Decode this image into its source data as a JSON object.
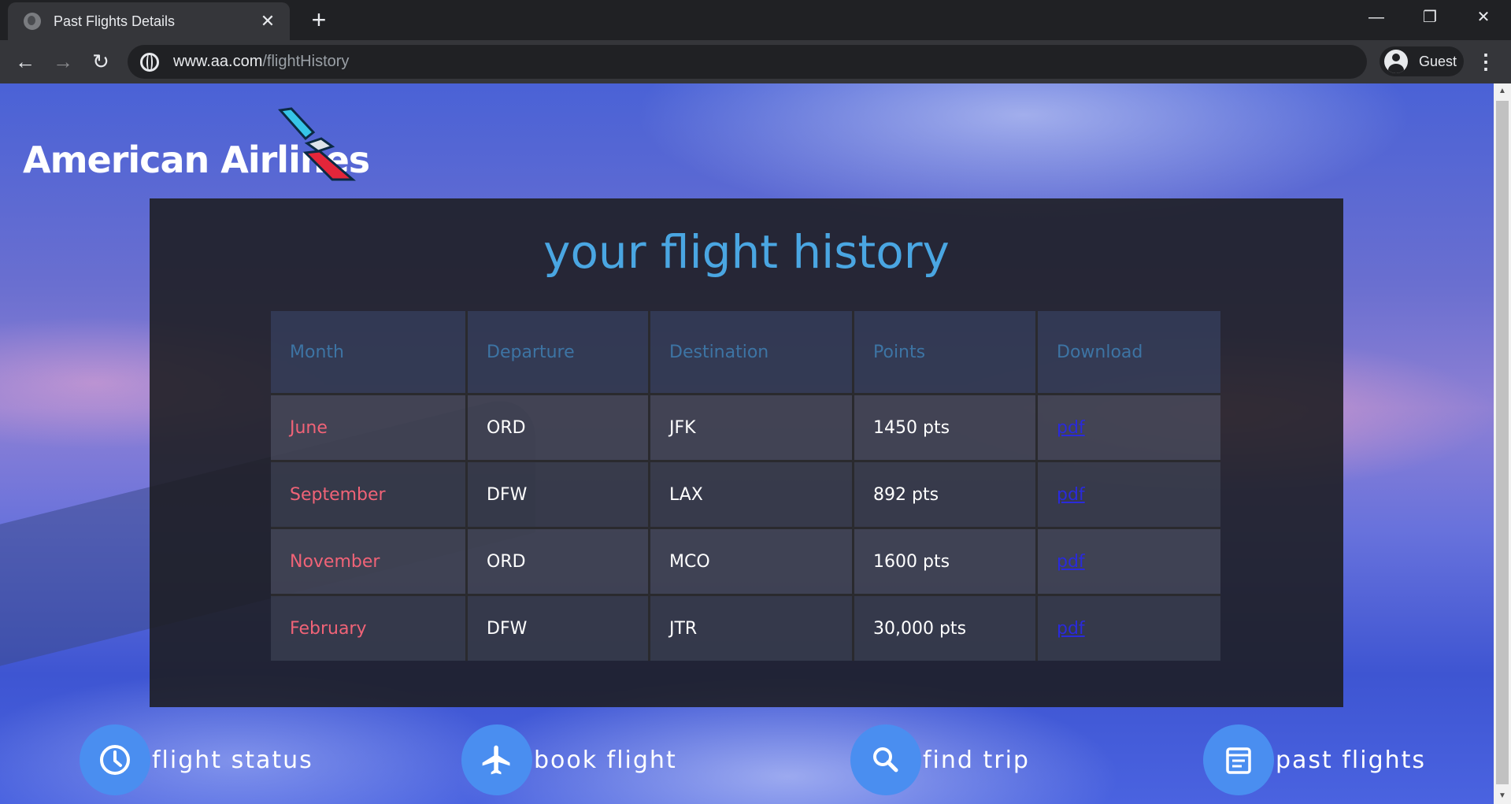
{
  "browser": {
    "tab_title": "Past Flights Details",
    "tab_close": "✕",
    "new_tab": "+",
    "url_host": "www.aa.com",
    "url_path": "/flightHistory",
    "profile_label": "Guest",
    "minimize": "—",
    "restore": "❐",
    "close": "✕",
    "back": "←",
    "forward": "→",
    "reload": "↻",
    "menu": "⋮"
  },
  "page": {
    "brand": "American Airlines",
    "title": "your flight history",
    "table": {
      "headers": [
        "Month",
        "Departure",
        "Destination",
        "Points",
        "Download"
      ],
      "rows": [
        {
          "month": "June",
          "departure": "ORD",
          "destination": "JFK",
          "points": "1450 pts",
          "download": "pdf"
        },
        {
          "month": "September",
          "departure": "DFW",
          "destination": "LAX",
          "points": "892 pts",
          "download": "pdf"
        },
        {
          "month": "November",
          "departure": "ORD",
          "destination": "MCO",
          "points": "1600 pts",
          "download": "pdf"
        },
        {
          "month": "February",
          "departure": "DFW",
          "destination": "JTR",
          "points": "30,000 pts",
          "download": "pdf"
        }
      ]
    },
    "nav": [
      {
        "label": "flight status",
        "icon": "clock-icon"
      },
      {
        "label": "book flight",
        "icon": "airplane-icon"
      },
      {
        "label": "find trip",
        "icon": "search-icon"
      },
      {
        "label": "past flights",
        "icon": "document-icon"
      }
    ]
  },
  "colors": {
    "title": "#4aa6e2",
    "month_text": "#f06377",
    "header_text": "#3d74a4",
    "link": "#2a2adb",
    "nav_circle": "#4a8ef0"
  }
}
